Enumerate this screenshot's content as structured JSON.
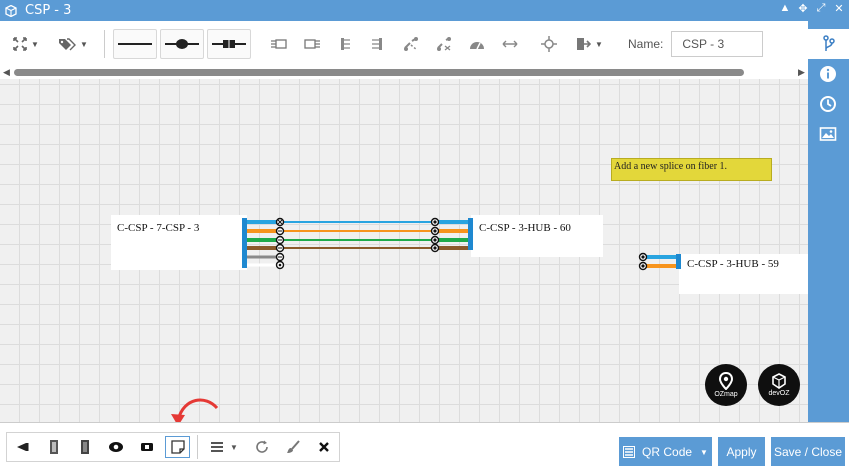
{
  "window": {
    "title": "CSP - 3"
  },
  "toolbar": {
    "name_label": "Name:",
    "name_value": "CSP - 3",
    "buttons": [
      "fit-icon",
      "tags-icon",
      "cable-icon",
      "cable-splice-icon",
      "connector-icon",
      "splitter-left-icon",
      "splitter-right-icon",
      "fan-out-icon",
      "fan-in-icon",
      "link-icon",
      "unlink-icon",
      "dashboard-icon",
      "resize-icon",
      "crosshair-icon",
      "export-icon"
    ]
  },
  "sidebar": {
    "icons": [
      "branch-icon",
      "info-icon",
      "history-icon",
      "image-icon"
    ]
  },
  "canvas": {
    "left_box": {
      "label": "C-CSP - 7-CSP - 3"
    },
    "right_box": {
      "label": "C-CSP - 3-HUB - 60"
    },
    "far_box": {
      "label": "C-CSP - 3-HUB - 59"
    },
    "note": {
      "text": "Add a new splice on fiber 1."
    },
    "fiber_colors": [
      "#29a4e0",
      "#f7941d",
      "#1faa4a",
      "#8b5a2b",
      "#8a8a8a",
      "#ffffff"
    ],
    "logos": [
      {
        "text": "OZmap",
        "icon": "map-pin-icon"
      },
      {
        "text": "devOZ",
        "icon": "cube-icon"
      }
    ]
  },
  "bottombar": {
    "tools": [
      "cable-end-icon",
      "box-icon",
      "rack-icon",
      "eye-icon",
      "ticket-icon",
      "note-icon",
      "list-icon",
      "refresh-icon",
      "brush-icon",
      "close-icon"
    ],
    "qr_label": "QR Code",
    "apply_label": "Apply",
    "save_label": "Save / Close"
  },
  "colors": {
    "accent": "#5b9bd5",
    "note": "#e3d73a",
    "annotation": "#e53935"
  }
}
